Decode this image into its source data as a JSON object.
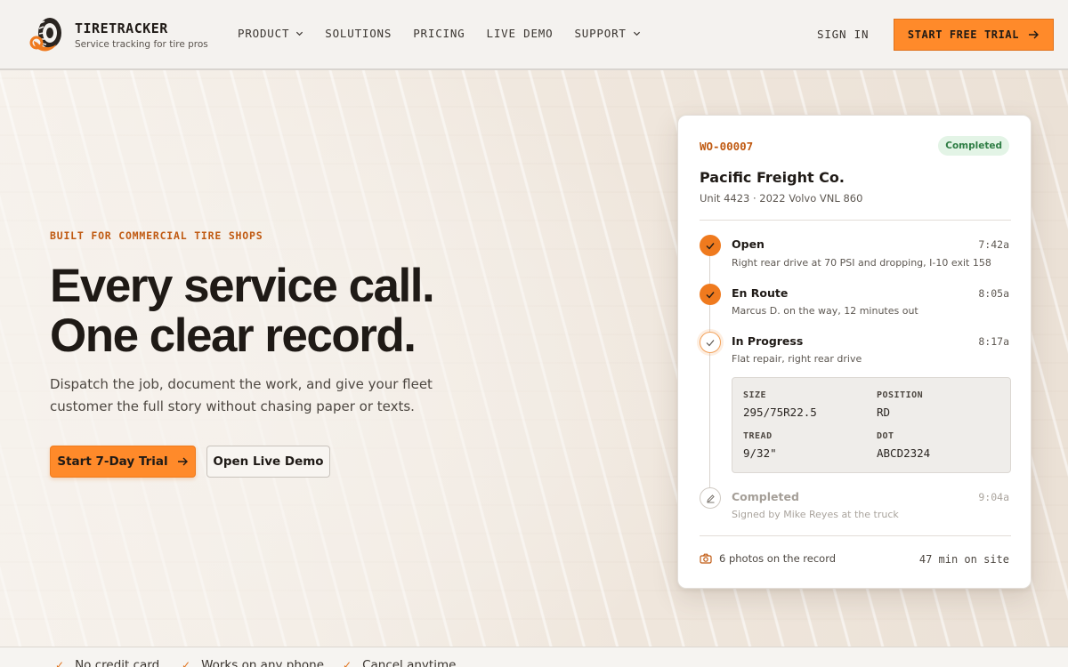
{
  "brand": {
    "name": "TIRETRACKER",
    "tagline": "Service tracking for tire pros"
  },
  "nav": {
    "items": [
      {
        "label": "PRODUCT",
        "has_dropdown": true
      },
      {
        "label": "SOLUTIONS",
        "has_dropdown": false
      },
      {
        "label": "PRICING",
        "has_dropdown": false
      },
      {
        "label": "LIVE DEMO",
        "has_dropdown": false
      },
      {
        "label": "SUPPORT",
        "has_dropdown": true
      }
    ],
    "sign_in": "SIGN IN",
    "cta": "START FREE TRIAL"
  },
  "hero": {
    "eyebrow": "BUILT FOR COMMERCIAL TIRE SHOPS",
    "headline_line1": "Every service call.",
    "headline_line2": "One clear record.",
    "subtext": "Dispatch the job, document the work, and give your fleet customer the full story without chasing paper or texts.",
    "primary_button": "Start 7-Day Trial",
    "secondary_button": "Open Live Demo"
  },
  "assurances": [
    "No credit card",
    "Works on any phone",
    "Cancel anytime"
  ],
  "work_order": {
    "id": "WO-00007",
    "status": "Completed",
    "customer": "Pacific Freight Co.",
    "unit": "Unit 4423 · 2022 Volvo VNL 860",
    "steps": [
      {
        "title": "Open",
        "time": "7:42a",
        "desc": "Right rear drive at 70 PSI and dropping, I-10 exit 158",
        "state": "done"
      },
      {
        "title": "En Route",
        "time": "8:05a",
        "desc": "Marcus D. on the way, 12 minutes out",
        "state": "done"
      },
      {
        "title": "In Progress",
        "time": "8:17a",
        "desc": "Flat repair, right rear drive",
        "state": "current"
      },
      {
        "title": "Completed",
        "time": "9:04a",
        "desc": "Signed by Mike Reyes at the truck",
        "state": "pending"
      }
    ],
    "specs": {
      "size_label": "SIZE",
      "size": "295/75R22.5",
      "position_label": "POSITION",
      "position": "RD",
      "tread_label": "TREAD",
      "tread": "9/32\"",
      "dot_label": "DOT",
      "dot": "ABCD2324"
    },
    "photos": "6 photos on the record",
    "on_site": "47 min on site"
  },
  "colors": {
    "accent": "#ff8a2a",
    "accent_dark": "#c05a12",
    "success_bg": "#e3f4e6",
    "success_text": "#2e7d44"
  }
}
